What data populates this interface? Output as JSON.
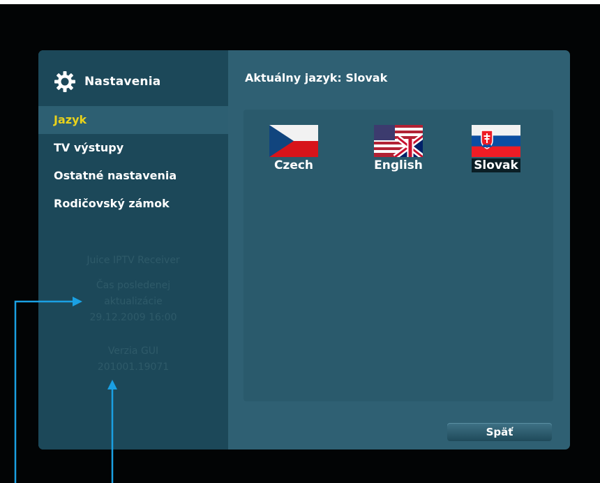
{
  "sidebar": {
    "title": "Nastavenia",
    "items": [
      {
        "label": "Jazyk",
        "active": true
      },
      {
        "label": "TV výstupy"
      },
      {
        "label": "Ostatné nastavenia"
      },
      {
        "label": "Rodičovský zámok"
      }
    ],
    "info": {
      "product": "Juice IPTV Receiver",
      "update_label_1": "Čas posledenej",
      "update_label_2": "aktualizácie",
      "update_value": "29.12.2009 16:00",
      "gui_label": "Verzia GUI",
      "gui_value": "201001.19071"
    }
  },
  "content": {
    "current_language": "Aktuálny jazyk: Slovak",
    "languages": [
      {
        "label": "Czech",
        "flag_icon": "czech-flag-icon"
      },
      {
        "label": "English",
        "flag_icon": "us-uk-flag-icon"
      },
      {
        "label": "Slovak",
        "flag_icon": "slovak-flag-icon",
        "selected": true
      }
    ],
    "back_label": "Späť"
  },
  "colors": {
    "accent_active": "#e9d21b",
    "window_bg": "#2f6073",
    "sidebar_bg": "#1c4859",
    "annotation_arrow": "#1aa0e3"
  }
}
